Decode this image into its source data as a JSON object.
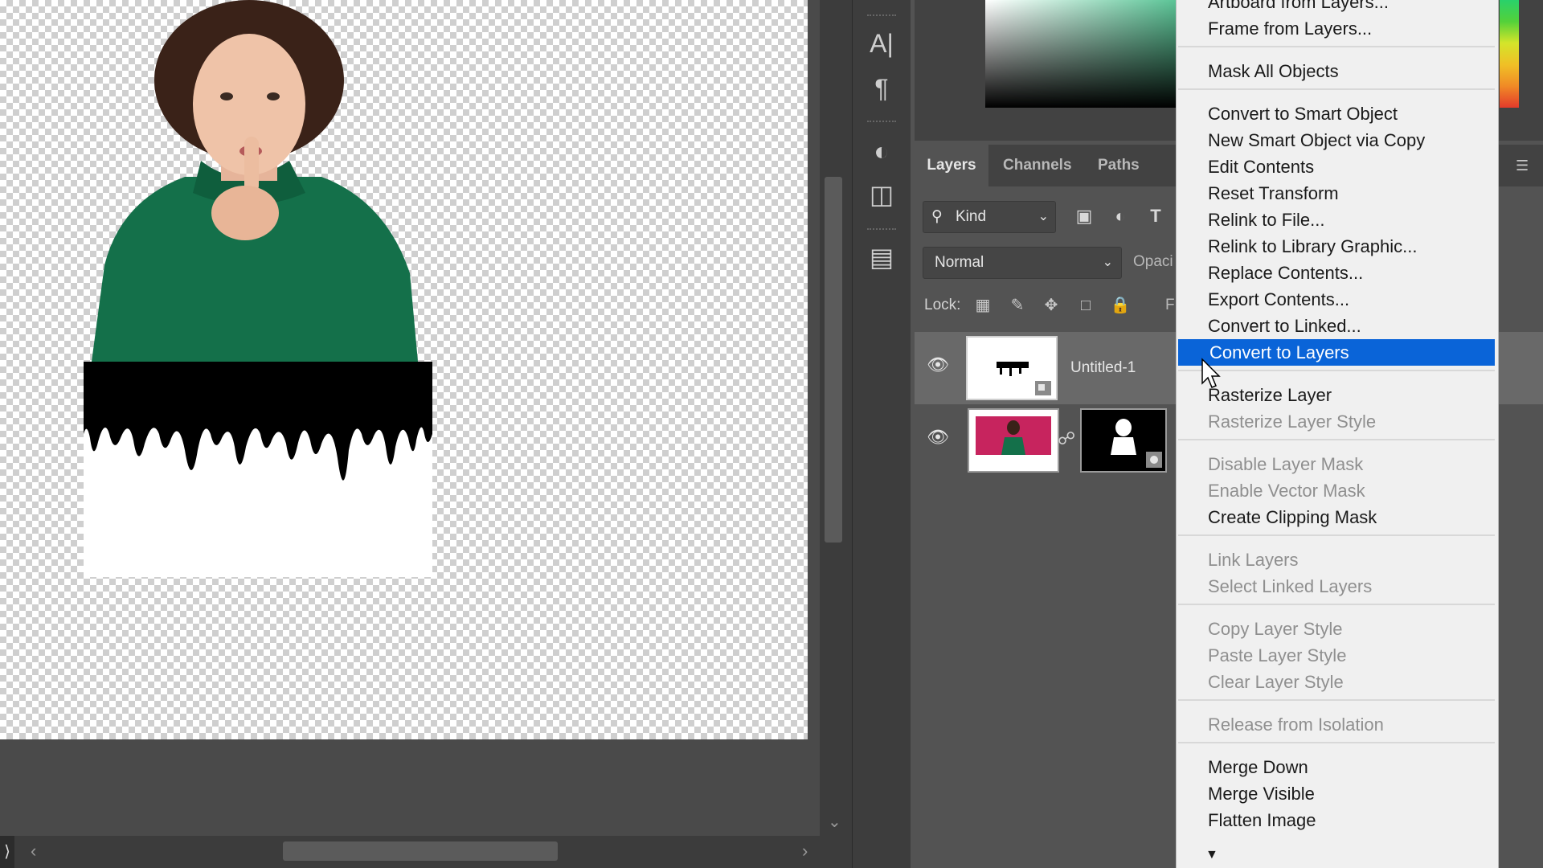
{
  "panels": {
    "tabs": [
      {
        "label": "Layers",
        "active": true
      },
      {
        "label": "Channels",
        "active": false
      },
      {
        "label": "Paths",
        "active": false
      }
    ],
    "filter": {
      "kind_label": "Kind"
    },
    "blend_mode": "Normal",
    "opacity_label": "Opaci",
    "lock_label": "Lock:",
    "fill_label": "F",
    "layers": [
      {
        "name": "Untitled-1",
        "visible": true,
        "type": "smart-object"
      },
      {
        "name": "",
        "visible": true,
        "type": "image-with-mask"
      }
    ]
  },
  "context_menu": {
    "items": [
      {
        "label": "Artboard from Layers...",
        "enabled": true
      },
      {
        "label": "Frame from Layers...",
        "enabled": true
      },
      {
        "separator": true
      },
      {
        "label": "Mask All Objects",
        "enabled": true
      },
      {
        "separator": true
      },
      {
        "label": "Convert to Smart Object",
        "enabled": true
      },
      {
        "label": "New Smart Object via Copy",
        "enabled": true
      },
      {
        "label": "Edit Contents",
        "enabled": true
      },
      {
        "label": "Reset Transform",
        "enabled": true
      },
      {
        "label": "Relink to File...",
        "enabled": true
      },
      {
        "label": "Relink to Library Graphic...",
        "enabled": true
      },
      {
        "label": "Replace Contents...",
        "enabled": true
      },
      {
        "label": "Export Contents...",
        "enabled": true
      },
      {
        "label": "Convert to Linked...",
        "enabled": true
      },
      {
        "label": "Convert to Layers",
        "enabled": true,
        "highlighted": true
      },
      {
        "separator": true
      },
      {
        "label": "Rasterize Layer",
        "enabled": true
      },
      {
        "label": "Rasterize Layer Style",
        "enabled": false
      },
      {
        "separator": true
      },
      {
        "label": "Disable Layer Mask",
        "enabled": false
      },
      {
        "label": "Enable Vector Mask",
        "enabled": false
      },
      {
        "label": "Create Clipping Mask",
        "enabled": true
      },
      {
        "separator": true
      },
      {
        "label": "Link Layers",
        "enabled": false
      },
      {
        "label": "Select Linked Layers",
        "enabled": false
      },
      {
        "separator": true
      },
      {
        "label": "Copy Layer Style",
        "enabled": false
      },
      {
        "label": "Paste Layer Style",
        "enabled": false
      },
      {
        "label": "Clear Layer Style",
        "enabled": false
      },
      {
        "separator": true
      },
      {
        "label": "Release from Isolation",
        "enabled": false
      },
      {
        "separator": true
      },
      {
        "label": "Merge Down",
        "enabled": true
      },
      {
        "label": "Merge Visible",
        "enabled": true
      },
      {
        "label": "Flatten Image",
        "enabled": true
      }
    ]
  },
  "colors": {
    "menu_highlight": "#0a64d8",
    "panel_bg": "#535353",
    "menu_bg": "#f0f0f0"
  }
}
